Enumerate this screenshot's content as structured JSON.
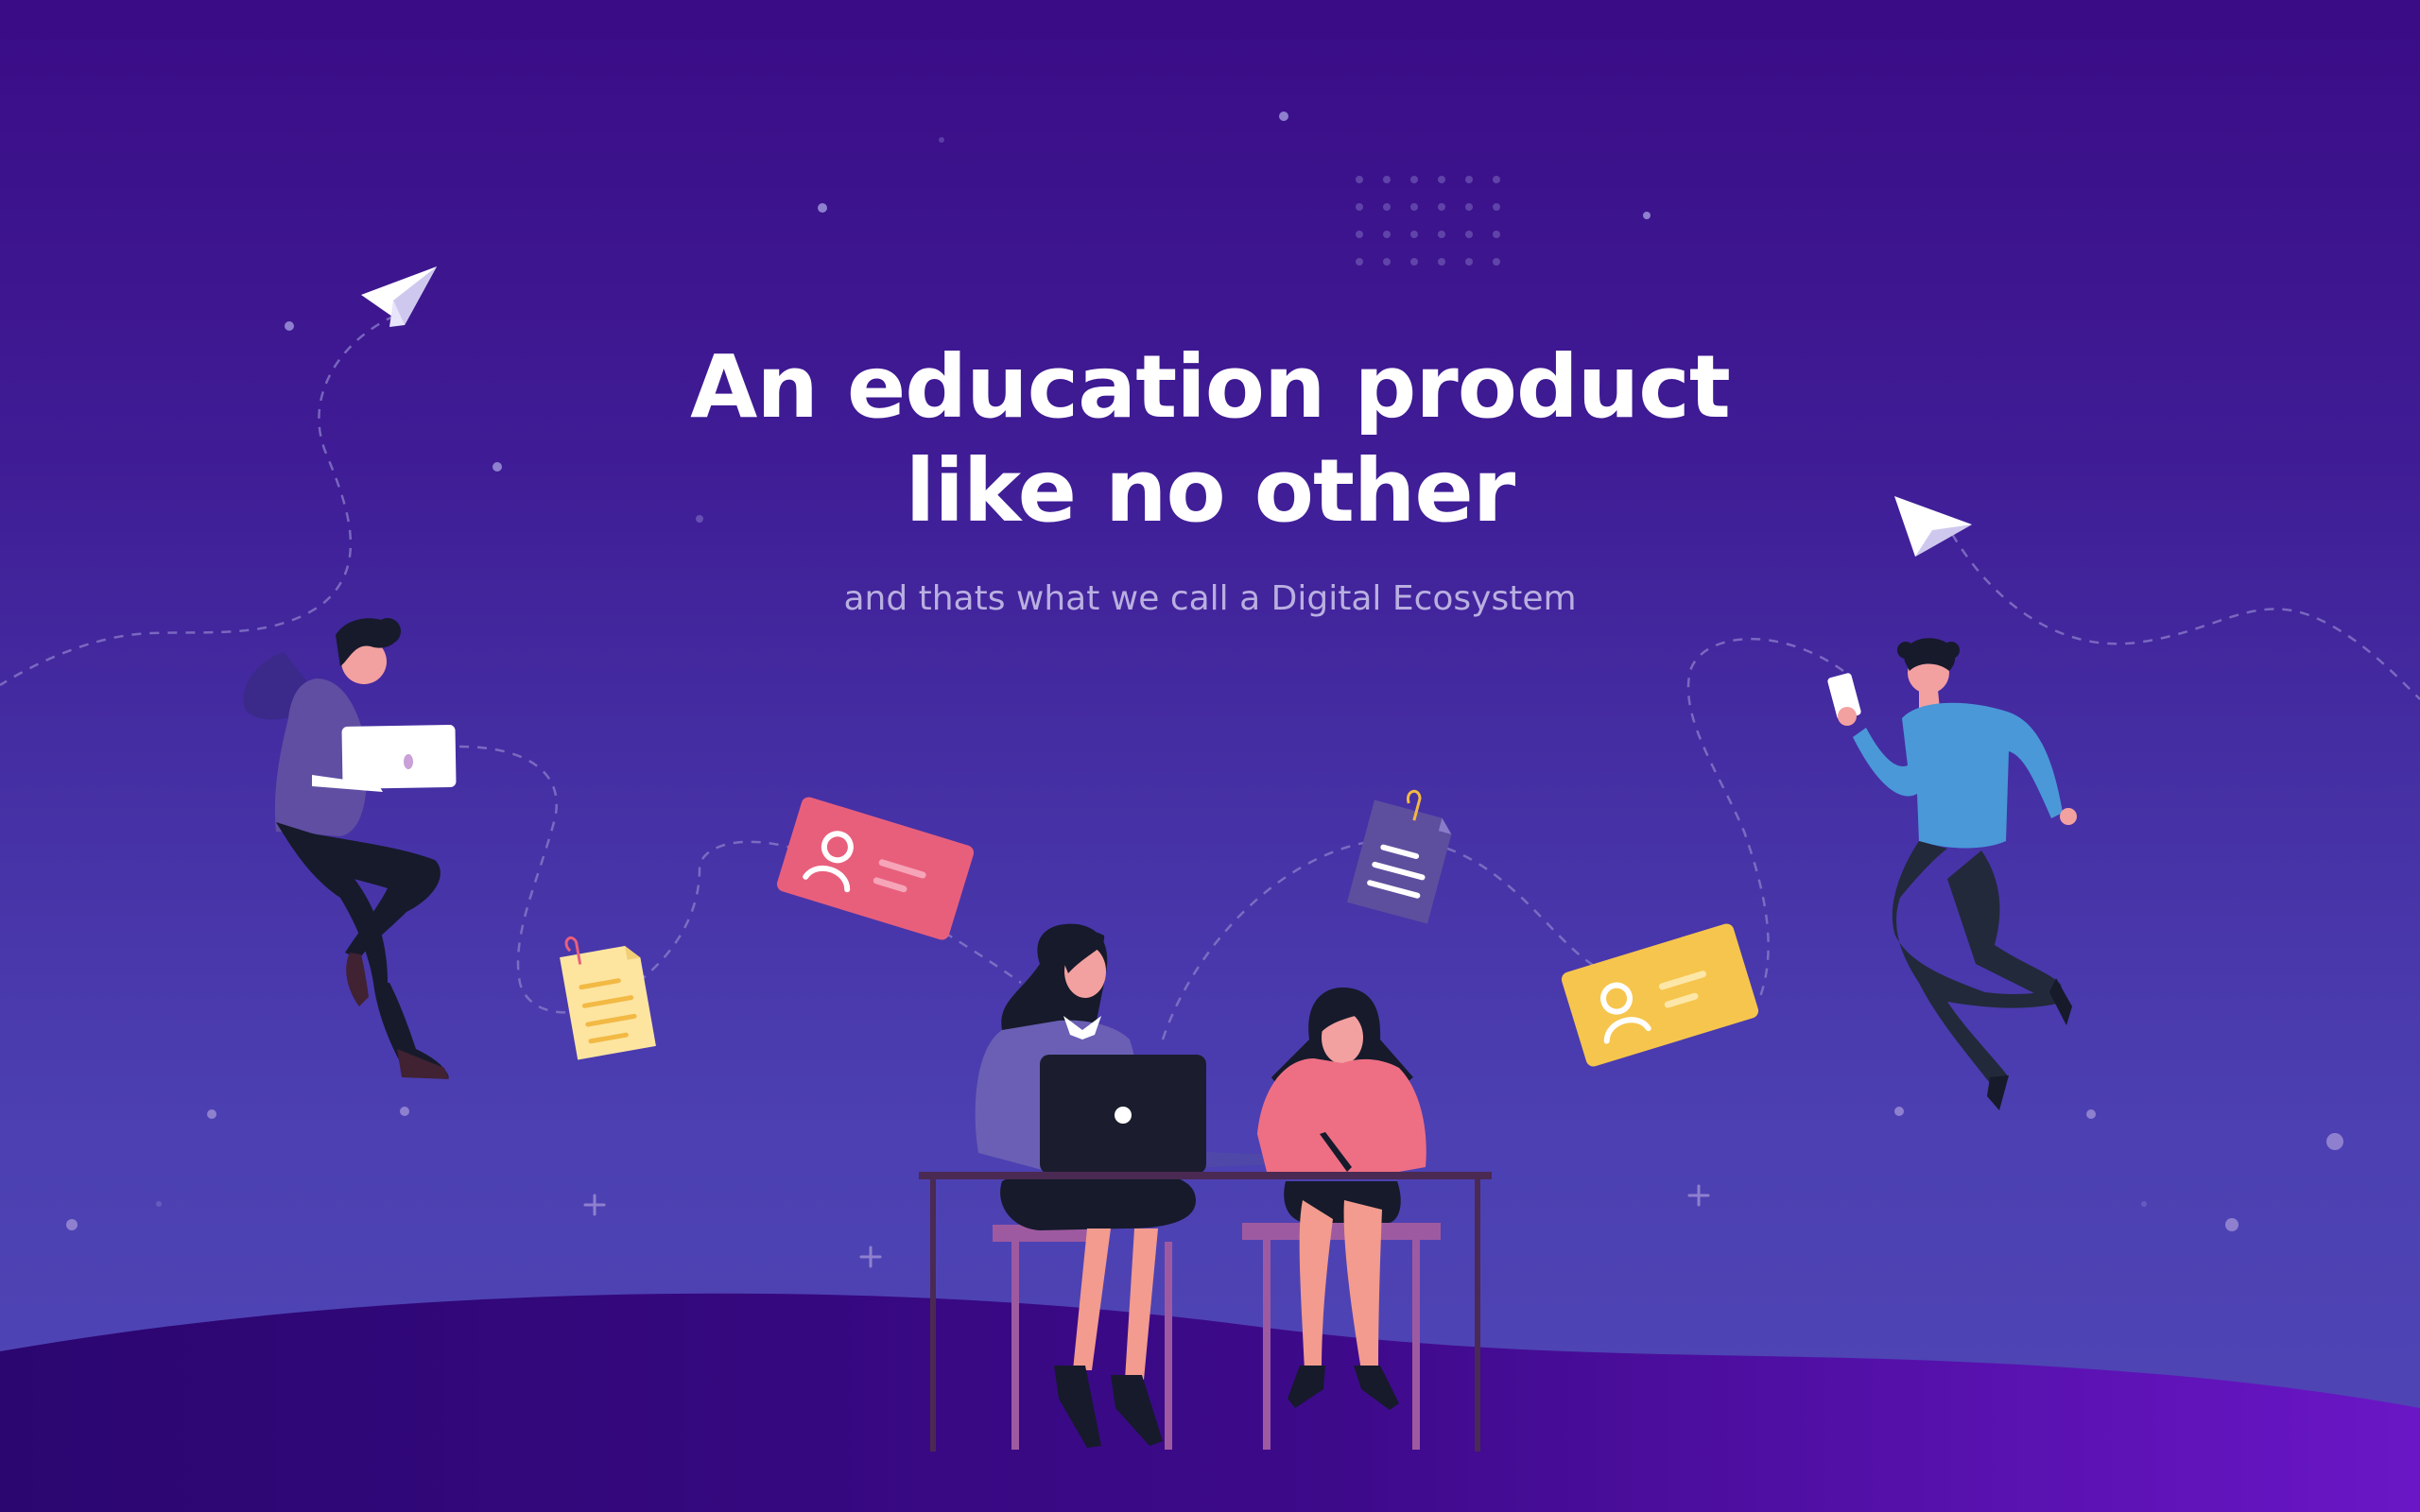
{
  "hero": {
    "title_line1": "An education product",
    "title_line2": "like no other",
    "subtitle": "and thats what we call a Digital Ecosystem"
  },
  "colors": {
    "bg_top": "#3a0c86",
    "bg_bottom": "#5046b5",
    "hill_dark": "#2b0670",
    "hill_light": "#6a16c6",
    "title": "#ffffff",
    "subtitle": "#b9afe0",
    "card_pink": "#e85f7c",
    "card_yellow": "#f6c54d",
    "doc_purple": "#5e4f9e",
    "doc_yellow": "#fde5a0",
    "shirt_blue": "#4a98d8",
    "desk": "#4a2a52"
  },
  "icons": [
    "paper-plane-icon",
    "user-card-icon",
    "document-icon"
  ]
}
